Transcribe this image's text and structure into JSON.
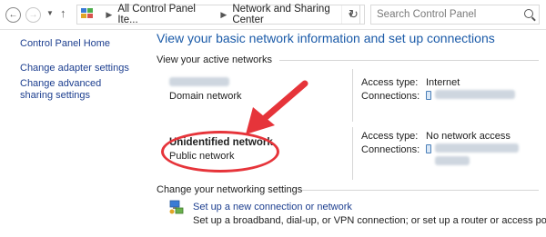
{
  "address_bar": {
    "breadcrumbs": [
      "All Control Panel Ite...",
      "Network and Sharing Center"
    ],
    "search_placeholder": "Search Control Panel"
  },
  "left_pane": {
    "links": [
      "Control Panel Home",
      "Change adapter settings",
      "Change advanced sharing settings"
    ]
  },
  "main": {
    "title": "View your basic network information and set up connections",
    "active_networks_heading": "View your active networks",
    "networks": [
      {
        "name": "",
        "type": "Domain network",
        "access_type_label": "Access type:",
        "access_type": "Internet",
        "connections_label": "Connections:"
      },
      {
        "name": "Unidentified network",
        "type": "Public network",
        "access_type_label": "Access type:",
        "access_type": "No network access",
        "connections_label": "Connections:"
      }
    ],
    "change_settings_heading": "Change your networking settings",
    "setup": {
      "link": "Set up a new connection or network",
      "description": "Set up a broadband, dial-up, or VPN connection; or set up a router or access point."
    }
  },
  "annotation": {
    "color": "#e6343a"
  },
  "icons": {
    "back": "back-arrow-icon",
    "forward": "forward-arrow-icon",
    "up": "up-arrow-icon",
    "control_panel": "control-panel-icon",
    "refresh": "refresh-icon",
    "search": "search-icon",
    "connection": "network-adapter-icon",
    "setup": "network-setup-icon"
  }
}
